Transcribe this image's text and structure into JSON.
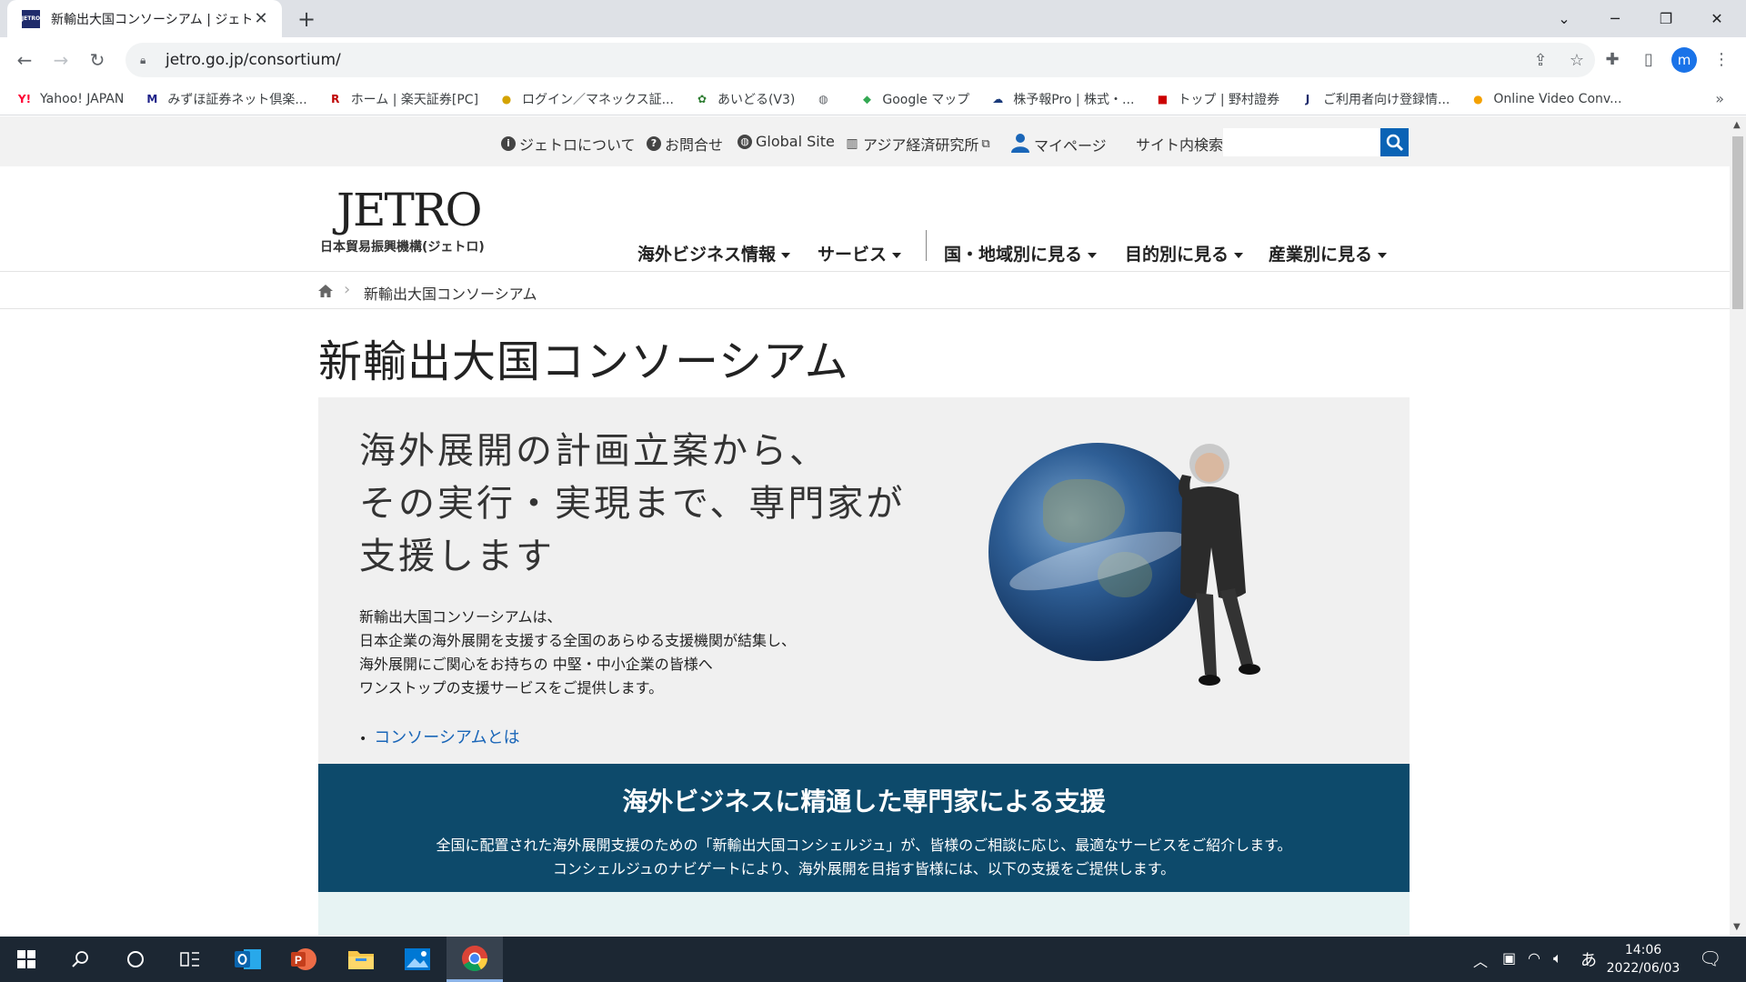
{
  "browser": {
    "tab_title": "新輸出大国コンソーシアム | ジェトロ",
    "tab_favicon_text": "JETRO",
    "url": "jetro.go.jp/consortium/",
    "profile_initial": "m"
  },
  "bookmarks": [
    {
      "label": "Yahoo! JAPAN",
      "icon": "Y!",
      "color": "#ff0033"
    },
    {
      "label": "みずほ証券ネット倶楽...",
      "icon": "M",
      "color": "#1d2088"
    },
    {
      "label": "ホーム | 楽天証券[PC]",
      "icon": "R",
      "color": "#bf0000"
    },
    {
      "label": "ログイン／マネックス証...",
      "icon": "●",
      "color": "#d4a300"
    },
    {
      "label": "あいどる(V3)",
      "icon": "✿",
      "color": "#2e7d32"
    },
    {
      "label": "",
      "icon": "◍",
      "color": "#5f6368"
    },
    {
      "label": "Google マップ",
      "icon": "⬥",
      "color": "#34a853"
    },
    {
      "label": "株予報Pro | 株式・...",
      "icon": "☁",
      "color": "#1a3a7a"
    },
    {
      "label": "トップ | 野村證券",
      "icon": "■",
      "color": "#cc0000"
    },
    {
      "label": "ご利用者向け登録情...",
      "icon": "J",
      "color": "#1f2b6b"
    },
    {
      "label": "Online Video Conv...",
      "icon": "●",
      "color": "#f4a100"
    }
  ],
  "utility_nav": {
    "about": "ジェトロについて",
    "contact": "お問合せ",
    "global": "Global Site",
    "ide": "アジア経済研究所",
    "mypage": "マイページ",
    "search_label": "サイト内検索",
    "search_value": ""
  },
  "logo": {
    "main": "JETRO",
    "sub": "日本貿易振興機構(ジェトロ)"
  },
  "global_nav": {
    "item1": "海外ビジネス情報",
    "item2": "サービス",
    "item3": "国・地域別に見る",
    "item4": "目的別に見る",
    "item5": "産業別に見る"
  },
  "breadcrumb": {
    "current": "新輸出大国コンソーシアム"
  },
  "page_title": "新輸出大国コンソーシアム",
  "hero": {
    "heading_lines": [
      "海外展開の計画立案から、",
      "その実行・実現まで、専門家が",
      "支援します"
    ],
    "body_lines": [
      "新輸出大国コンソーシアムは、",
      "日本企業の海外展開を支援する全国のあらゆる支援機関が結集し、",
      "海外展開にご関心をお持ちの 中堅・中小企業の皆様へ",
      "ワンストップの支援サービスをご提供します。"
    ],
    "link": "コンソーシアムとは"
  },
  "band": {
    "title": "海外ビジネスに精通した専門家による支援",
    "line1": "全国に配置された海外展開支援のための「新輸出大国コンシェルジュ」が、皆様のご相談に応じ、最適なサービスをご紹介します。",
    "line2": "コンシェルジュのナビゲートにより、海外展開を目指す皆様には、以下の支援をご提供します。"
  },
  "taskbar": {
    "ime": "あ",
    "time": "14:06",
    "date": "2022/06/03"
  }
}
